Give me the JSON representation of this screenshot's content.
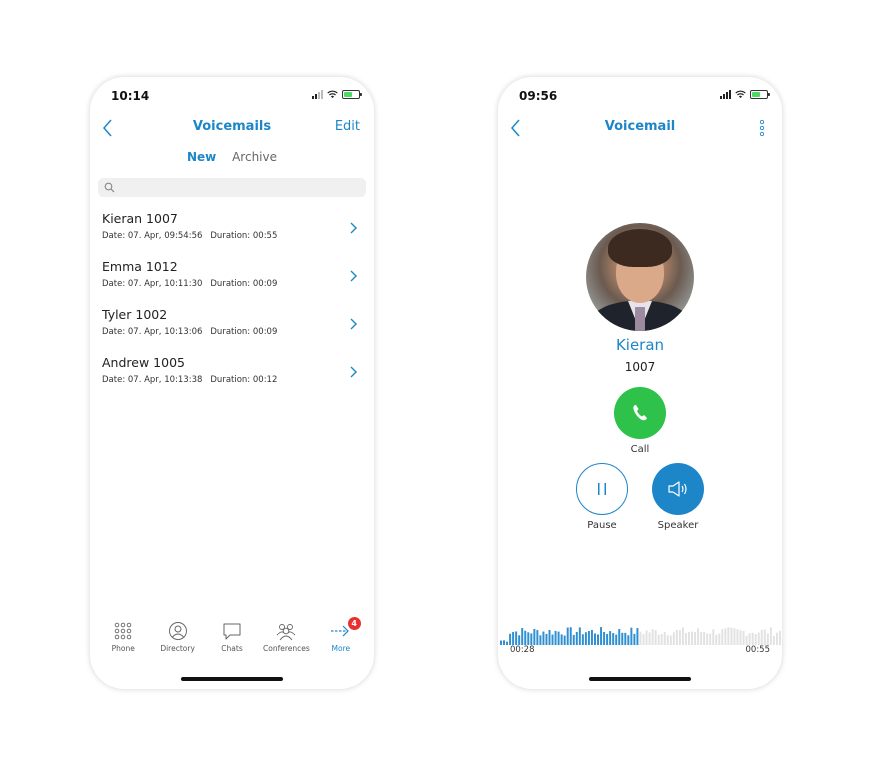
{
  "left_screen": {
    "status": {
      "time": "10:14"
    },
    "nav": {
      "title": "Voicemails",
      "edit_label": "Edit"
    },
    "tabs": [
      {
        "label": "New",
        "active": true
      },
      {
        "label": "Archive",
        "active": false
      }
    ],
    "search": {
      "placeholder": "",
      "value": ""
    },
    "voicemails": [
      {
        "name": "Kieran 1007",
        "date": "Date: 07. Apr, 09:54:56",
        "duration": "Duration: 00:55"
      },
      {
        "name": "Emma 1012",
        "date": "Date: 07. Apr, 10:11:30",
        "duration": "Duration: 00:09"
      },
      {
        "name": "Tyler 1002",
        "date": "Date: 07. Apr, 10:13:06",
        "duration": "Duration: 00:09"
      },
      {
        "name": "Andrew 1005",
        "date": "Date: 07. Apr, 10:13:38",
        "duration": "Duration: 00:12"
      }
    ],
    "tabbar": [
      {
        "label": "Phone",
        "icon": "keypad-icon",
        "active": false
      },
      {
        "label": "Directory",
        "icon": "person-icon",
        "active": false
      },
      {
        "label": "Chats",
        "icon": "chat-bubble-icon",
        "active": false
      },
      {
        "label": "Conferences",
        "icon": "group-icon",
        "active": false
      },
      {
        "label": "More",
        "icon": "more-arrow-icon",
        "active": true,
        "badge": "4"
      }
    ]
  },
  "right_screen": {
    "status": {
      "time": "09:56"
    },
    "nav": {
      "title": "Voicemail"
    },
    "contact": {
      "name": "Kieran",
      "extension": "1007"
    },
    "actions": {
      "call_label": "Call",
      "pause_label": "Pause",
      "speaker_label": "Speaker"
    },
    "playback": {
      "current_time": "00:28",
      "total_time": "00:55",
      "progress": 0.49
    }
  },
  "colors": {
    "accent": "#1d86c8",
    "call_green": "#2ec24b",
    "badge_red": "#e8312f"
  }
}
